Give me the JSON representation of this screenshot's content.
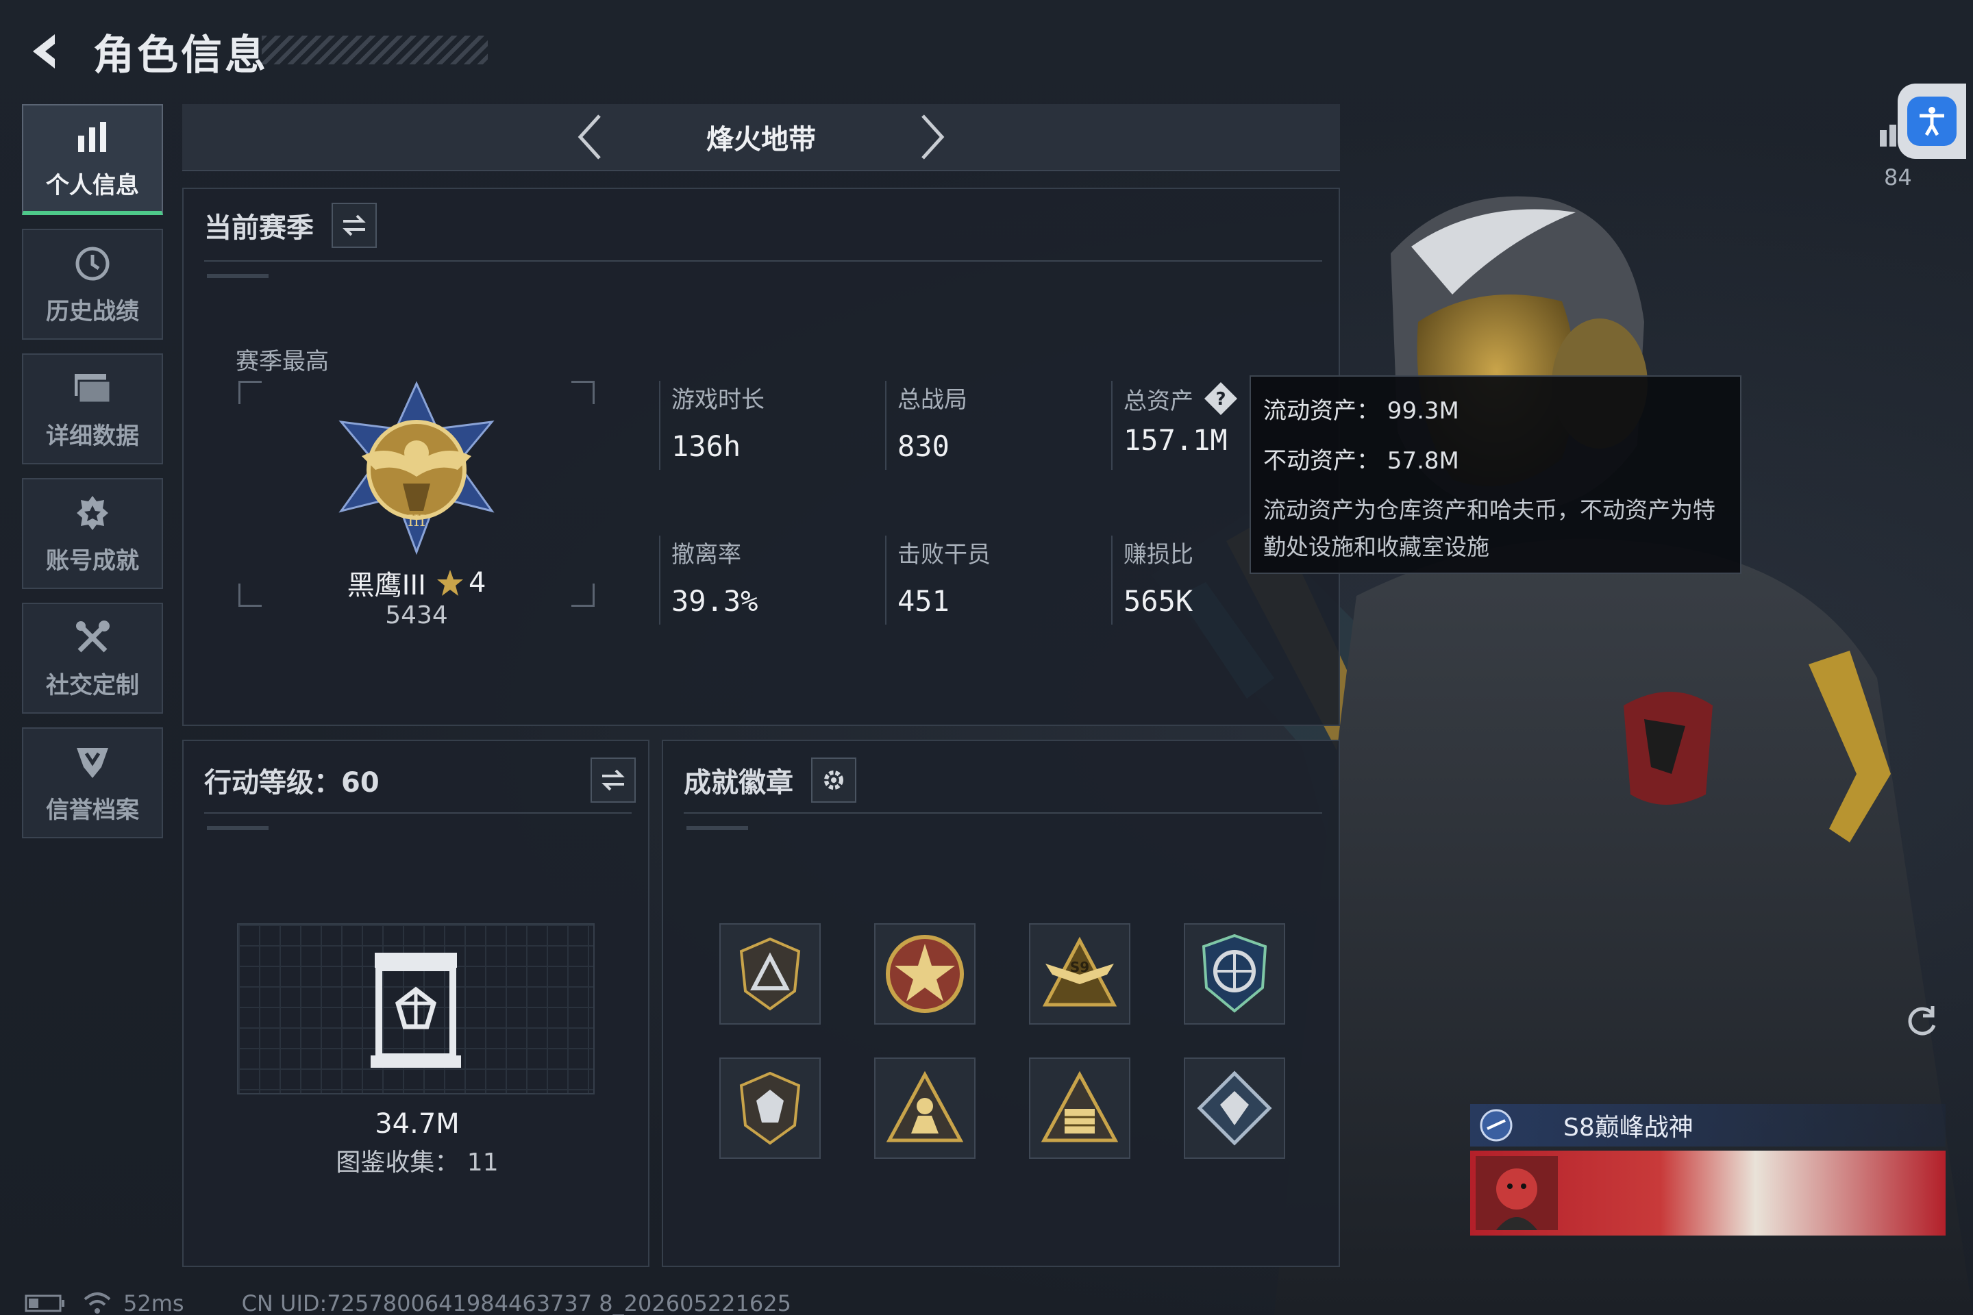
{
  "header": {
    "title": "角色信息"
  },
  "sidebar": {
    "items": [
      {
        "label": "个人信息",
        "icon": "bar-chart-icon",
        "active": true
      },
      {
        "label": "历史战绩",
        "icon": "history-clock-icon",
        "active": false
      },
      {
        "label": "详细数据",
        "icon": "folder-icon",
        "active": false
      },
      {
        "label": "账号成就",
        "icon": "achievement-icon",
        "active": false
      },
      {
        "label": "社交定制",
        "icon": "tools-icon",
        "active": false
      },
      {
        "label": "信誉档案",
        "icon": "credit-shield-icon",
        "active": false
      }
    ]
  },
  "mode": {
    "name": "烽火地带"
  },
  "season": {
    "title": "当前赛季",
    "best_label": "赛季最高",
    "rank_name": "黑鹰III",
    "rank_stars": "4",
    "rank_score": "5434",
    "stats": [
      {
        "label": "游戏时长",
        "value": "136h"
      },
      {
        "label": "总战局",
        "value": "830"
      },
      {
        "label": "总资产",
        "value": "157.1M"
      },
      {
        "label": "撤离率",
        "value": "39.3%"
      },
      {
        "label": "击败干员",
        "value": "451"
      },
      {
        "label": "赚损比",
        "value": "565K"
      }
    ]
  },
  "tooltip": {
    "liquid": "流动资产：  99.3M",
    "fixed": "不动资产：  57.8M",
    "note": "流动资产为仓库资产和哈夫币，不动资产为特勤处设施和收藏室设施"
  },
  "level": {
    "title": "行动等级：60",
    "value": "34.7M",
    "collection": "图鉴收集：  11"
  },
  "achievements": {
    "title": "成就徽章",
    "badges": [
      "triangle-shield-badge",
      "star-emblem-badge",
      "s9-winged-badge",
      "arrows-globe-badge",
      "crystal-shield-badge",
      "soldier-triangle-badge",
      "crate-triangle-badge",
      "gem-diamond-badge"
    ]
  },
  "player_card": {
    "title": "S8巅峰战神"
  },
  "side_counter": "84",
  "footer": {
    "ping": "52ms",
    "uid": "CN UID:7257800641984463737 8_202605221625"
  },
  "colors": {
    "accent": "#4ec98a",
    "gold": "#c9a44a",
    "access_blue": "#2d7be6"
  }
}
